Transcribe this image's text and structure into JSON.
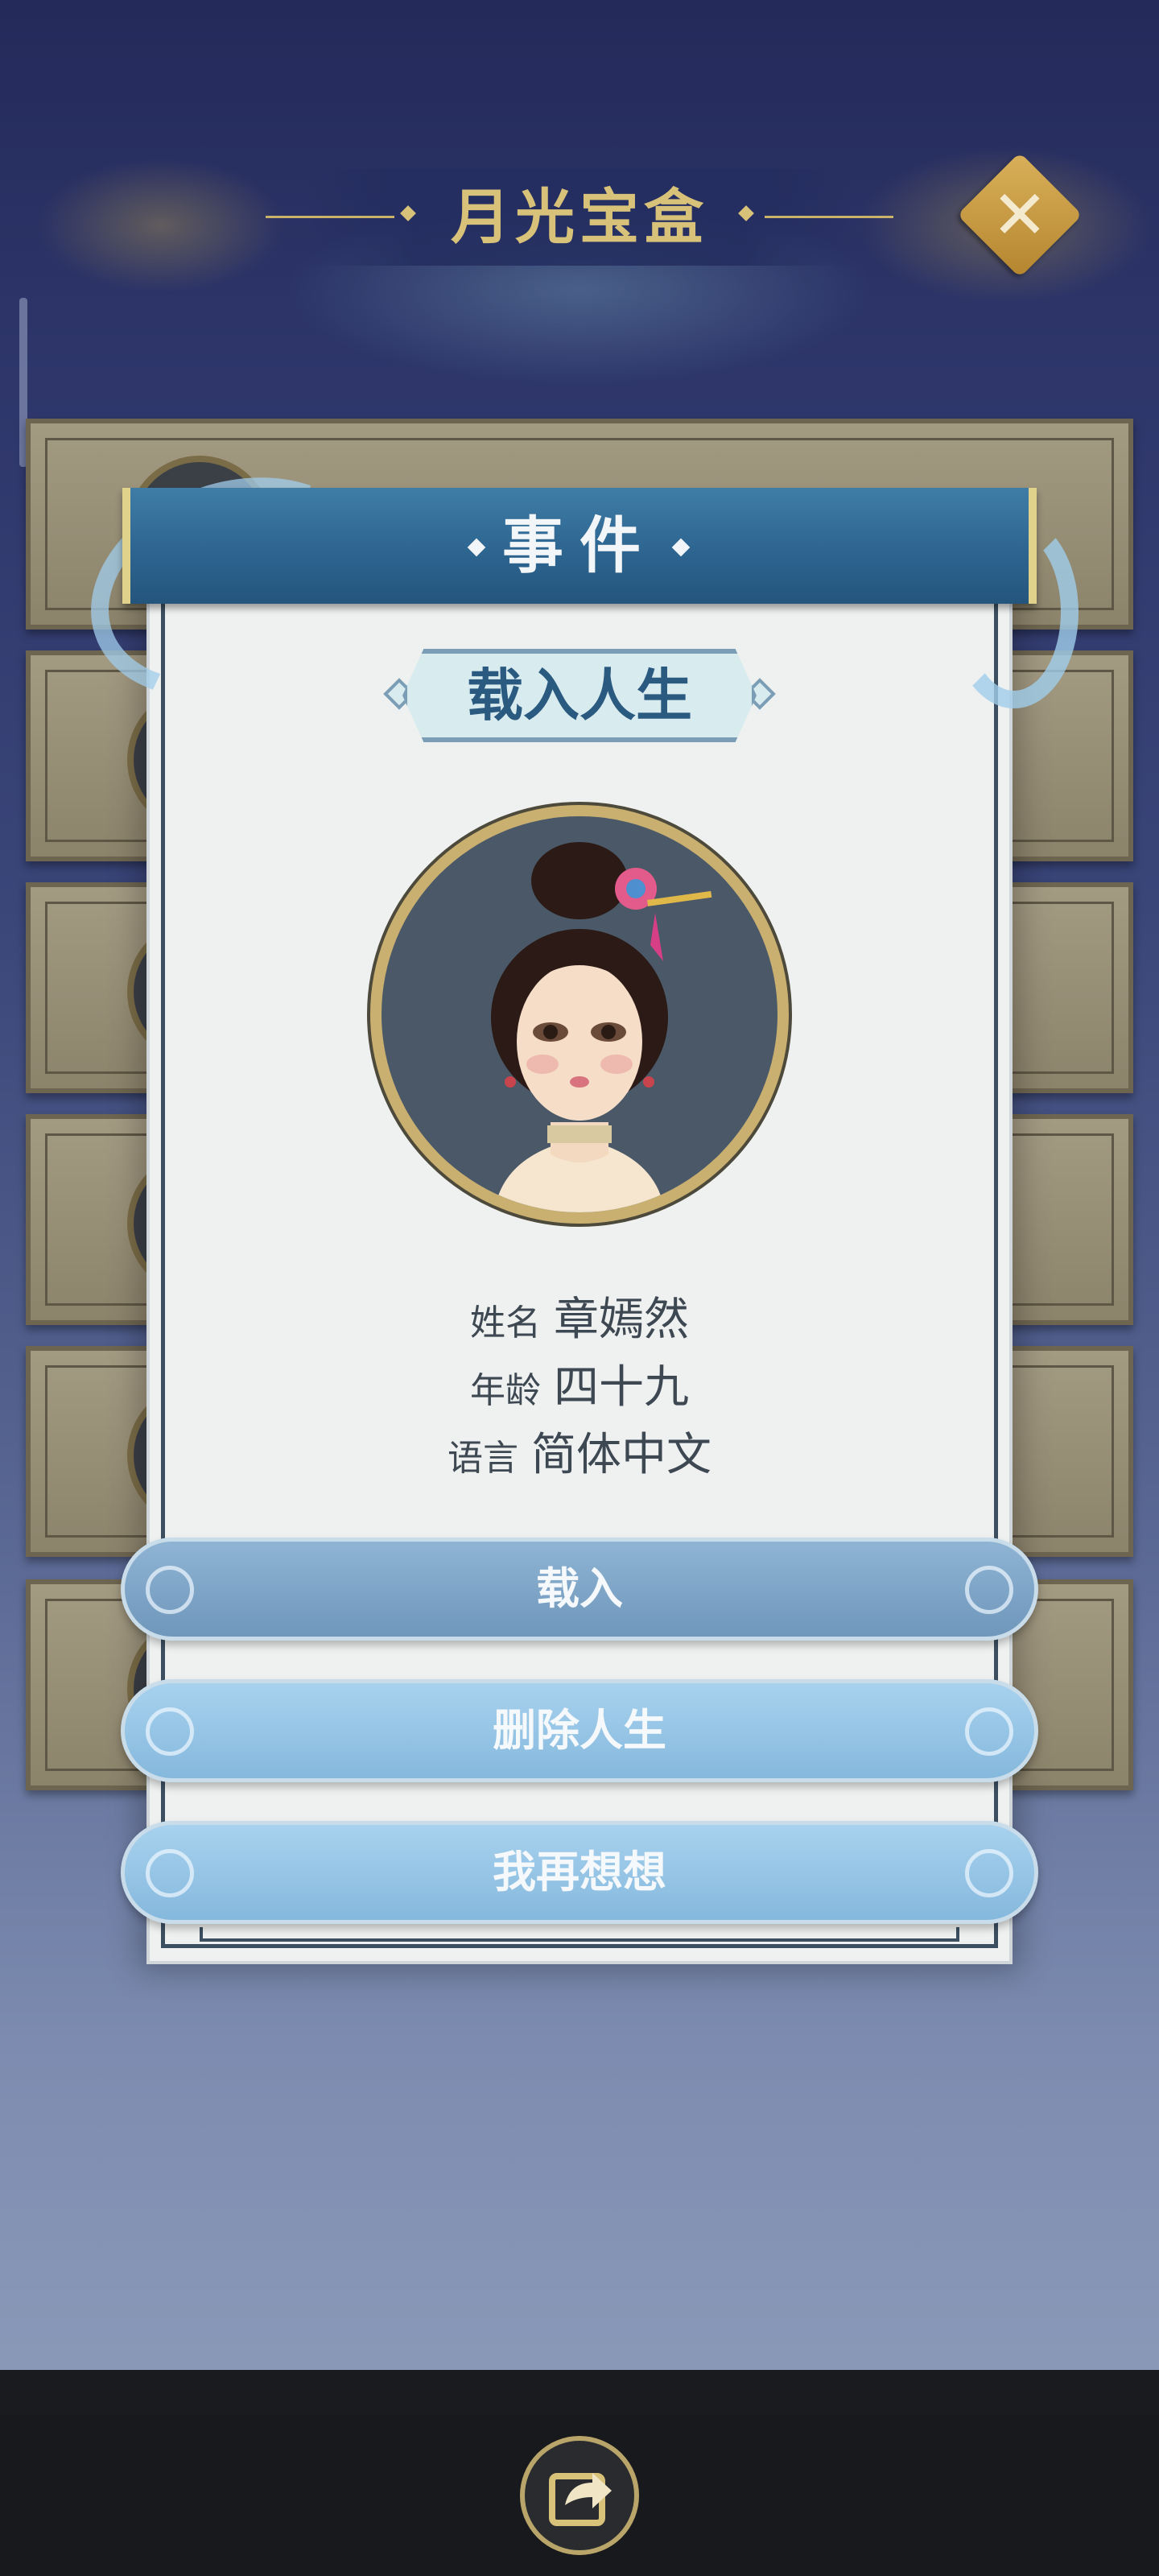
{
  "header": {
    "title": "月光宝盒",
    "close_icon": "close-icon"
  },
  "dialog": {
    "title": "事件",
    "subtitle": "载入人生",
    "character": {
      "name_label": "姓名",
      "name_value": "章嫣然",
      "age_label": "年龄",
      "age_value": "四十九",
      "language_label": "语言",
      "language_value": "简体中文"
    },
    "buttons": {
      "load": "载入",
      "delete": "删除人生",
      "cancel": "我再想想"
    }
  },
  "bottom_bar": {
    "share_icon": "share-icon"
  },
  "colors": {
    "header_blue": "#2d6590",
    "gold": "#c9b070",
    "button_blue": "#85b8dd"
  }
}
